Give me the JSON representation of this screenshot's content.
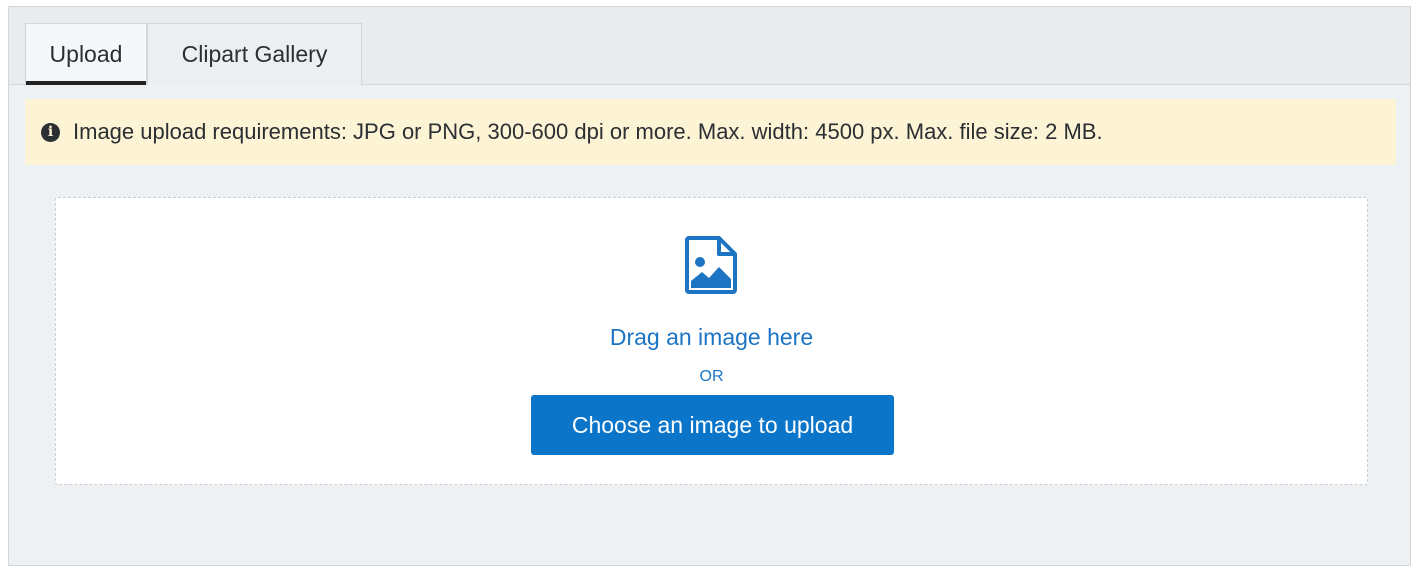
{
  "tabs": [
    {
      "label": "Upload",
      "active": true
    },
    {
      "label": "Clipart Gallery",
      "active": false
    }
  ],
  "notice": {
    "icon": "info-icon",
    "text": "Image upload requirements: JPG or PNG, 300-600 dpi or more. Max. width: 4500 px. Max. file size: 2 MB."
  },
  "dropzone": {
    "icon": "image-file-icon",
    "drag_text": "Drag an image here",
    "or_text": "OR",
    "button_label": "Choose an image to upload"
  },
  "colors": {
    "accent": "#0a75c9",
    "link": "#1c74c3",
    "notice_bg": "#fdf3d5",
    "panel_bg": "#eef1f4"
  }
}
